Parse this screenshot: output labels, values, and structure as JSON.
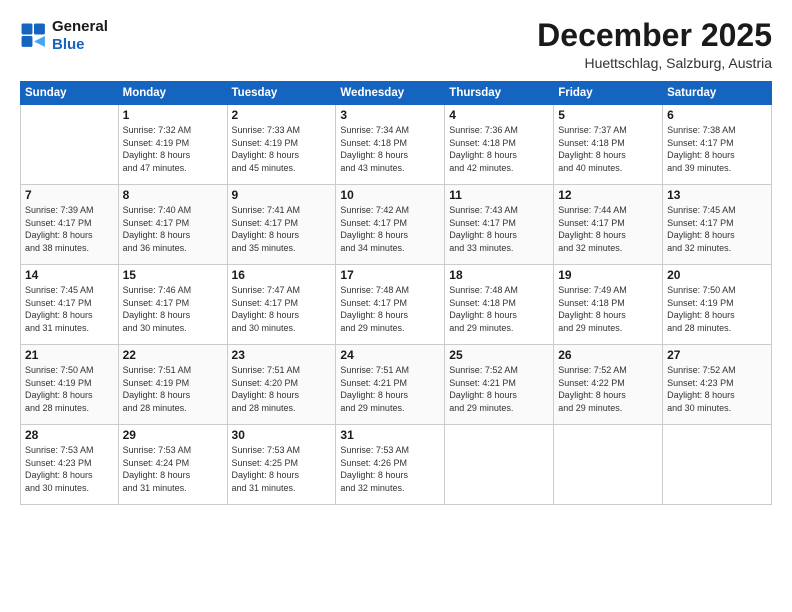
{
  "header": {
    "logo_line1": "General",
    "logo_line2": "Blue",
    "month": "December 2025",
    "location": "Huettschlag, Salzburg, Austria"
  },
  "weekdays": [
    "Sunday",
    "Monday",
    "Tuesday",
    "Wednesday",
    "Thursday",
    "Friday",
    "Saturday"
  ],
  "weeks": [
    [
      {
        "day": "",
        "info": ""
      },
      {
        "day": "1",
        "info": "Sunrise: 7:32 AM\nSunset: 4:19 PM\nDaylight: 8 hours\nand 47 minutes."
      },
      {
        "day": "2",
        "info": "Sunrise: 7:33 AM\nSunset: 4:19 PM\nDaylight: 8 hours\nand 45 minutes."
      },
      {
        "day": "3",
        "info": "Sunrise: 7:34 AM\nSunset: 4:18 PM\nDaylight: 8 hours\nand 43 minutes."
      },
      {
        "day": "4",
        "info": "Sunrise: 7:36 AM\nSunset: 4:18 PM\nDaylight: 8 hours\nand 42 minutes."
      },
      {
        "day": "5",
        "info": "Sunrise: 7:37 AM\nSunset: 4:18 PM\nDaylight: 8 hours\nand 40 minutes."
      },
      {
        "day": "6",
        "info": "Sunrise: 7:38 AM\nSunset: 4:17 PM\nDaylight: 8 hours\nand 39 minutes."
      }
    ],
    [
      {
        "day": "7",
        "info": "Sunrise: 7:39 AM\nSunset: 4:17 PM\nDaylight: 8 hours\nand 38 minutes."
      },
      {
        "day": "8",
        "info": "Sunrise: 7:40 AM\nSunset: 4:17 PM\nDaylight: 8 hours\nand 36 minutes."
      },
      {
        "day": "9",
        "info": "Sunrise: 7:41 AM\nSunset: 4:17 PM\nDaylight: 8 hours\nand 35 minutes."
      },
      {
        "day": "10",
        "info": "Sunrise: 7:42 AM\nSunset: 4:17 PM\nDaylight: 8 hours\nand 34 minutes."
      },
      {
        "day": "11",
        "info": "Sunrise: 7:43 AM\nSunset: 4:17 PM\nDaylight: 8 hours\nand 33 minutes."
      },
      {
        "day": "12",
        "info": "Sunrise: 7:44 AM\nSunset: 4:17 PM\nDaylight: 8 hours\nand 32 minutes."
      },
      {
        "day": "13",
        "info": "Sunrise: 7:45 AM\nSunset: 4:17 PM\nDaylight: 8 hours\nand 32 minutes."
      }
    ],
    [
      {
        "day": "14",
        "info": "Sunrise: 7:45 AM\nSunset: 4:17 PM\nDaylight: 8 hours\nand 31 minutes."
      },
      {
        "day": "15",
        "info": "Sunrise: 7:46 AM\nSunset: 4:17 PM\nDaylight: 8 hours\nand 30 minutes."
      },
      {
        "day": "16",
        "info": "Sunrise: 7:47 AM\nSunset: 4:17 PM\nDaylight: 8 hours\nand 30 minutes."
      },
      {
        "day": "17",
        "info": "Sunrise: 7:48 AM\nSunset: 4:17 PM\nDaylight: 8 hours\nand 29 minutes."
      },
      {
        "day": "18",
        "info": "Sunrise: 7:48 AM\nSunset: 4:18 PM\nDaylight: 8 hours\nand 29 minutes."
      },
      {
        "day": "19",
        "info": "Sunrise: 7:49 AM\nSunset: 4:18 PM\nDaylight: 8 hours\nand 29 minutes."
      },
      {
        "day": "20",
        "info": "Sunrise: 7:50 AM\nSunset: 4:19 PM\nDaylight: 8 hours\nand 28 minutes."
      }
    ],
    [
      {
        "day": "21",
        "info": "Sunrise: 7:50 AM\nSunset: 4:19 PM\nDaylight: 8 hours\nand 28 minutes."
      },
      {
        "day": "22",
        "info": "Sunrise: 7:51 AM\nSunset: 4:19 PM\nDaylight: 8 hours\nand 28 minutes."
      },
      {
        "day": "23",
        "info": "Sunrise: 7:51 AM\nSunset: 4:20 PM\nDaylight: 8 hours\nand 28 minutes."
      },
      {
        "day": "24",
        "info": "Sunrise: 7:51 AM\nSunset: 4:21 PM\nDaylight: 8 hours\nand 29 minutes."
      },
      {
        "day": "25",
        "info": "Sunrise: 7:52 AM\nSunset: 4:21 PM\nDaylight: 8 hours\nand 29 minutes."
      },
      {
        "day": "26",
        "info": "Sunrise: 7:52 AM\nSunset: 4:22 PM\nDaylight: 8 hours\nand 29 minutes."
      },
      {
        "day": "27",
        "info": "Sunrise: 7:52 AM\nSunset: 4:23 PM\nDaylight: 8 hours\nand 30 minutes."
      }
    ],
    [
      {
        "day": "28",
        "info": "Sunrise: 7:53 AM\nSunset: 4:23 PM\nDaylight: 8 hours\nand 30 minutes."
      },
      {
        "day": "29",
        "info": "Sunrise: 7:53 AM\nSunset: 4:24 PM\nDaylight: 8 hours\nand 31 minutes."
      },
      {
        "day": "30",
        "info": "Sunrise: 7:53 AM\nSunset: 4:25 PM\nDaylight: 8 hours\nand 31 minutes."
      },
      {
        "day": "31",
        "info": "Sunrise: 7:53 AM\nSunset: 4:26 PM\nDaylight: 8 hours\nand 32 minutes."
      },
      {
        "day": "",
        "info": ""
      },
      {
        "day": "",
        "info": ""
      },
      {
        "day": "",
        "info": ""
      }
    ]
  ]
}
